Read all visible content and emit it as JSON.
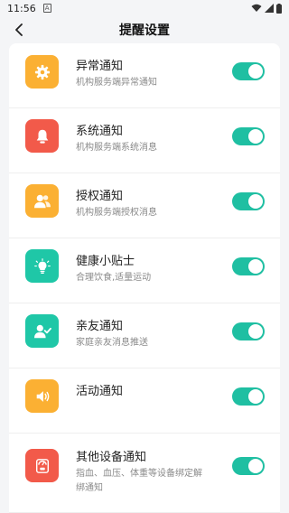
{
  "status_bar": {
    "time": "11:56",
    "sim_label": "A"
  },
  "header": {
    "title": "提醒设置"
  },
  "items": [
    {
      "title": "异常通知",
      "desc": "机构服务端异常通知",
      "icon": "gear-icon",
      "color": "#fbb033",
      "enabled": true
    },
    {
      "title": "系统通知",
      "desc": "机构服务端系统消息",
      "icon": "bell-icon",
      "color": "#f25a4a",
      "enabled": true
    },
    {
      "title": "授权通知",
      "desc": "机构服务端授权消息",
      "icon": "users-icon",
      "color": "#fbb033",
      "enabled": true
    },
    {
      "title": "健康小贴士",
      "desc": "合理饮食,适量运动",
      "icon": "lightbulb-icon",
      "color": "#1fc7a7",
      "enabled": true
    },
    {
      "title": "亲友通知",
      "desc": "家庭亲友消息推送",
      "icon": "user-check-icon",
      "color": "#1fc7a7",
      "enabled": true
    },
    {
      "title": "活动通知",
      "desc": "",
      "icon": "speaker-icon",
      "color": "#fbb033",
      "enabled": true
    },
    {
      "title": "其他设备通知",
      "desc": "指血、血压、体重等设备绑定解绑通知",
      "icon": "scale-icon",
      "color": "#f25a4a",
      "enabled": true
    }
  ]
}
